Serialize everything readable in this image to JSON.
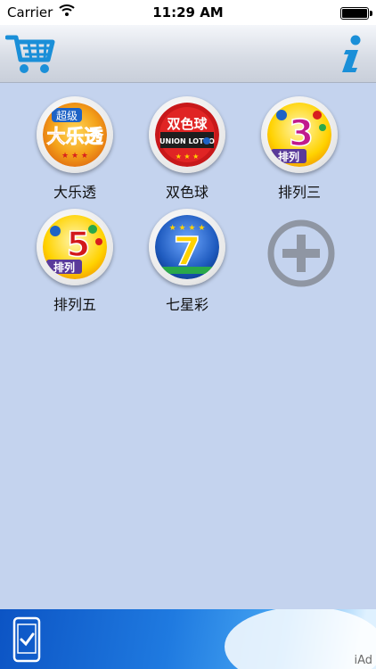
{
  "status_bar": {
    "carrier": "Carrier",
    "time": "11:29 AM"
  },
  "toolbar": {
    "cart_icon": "shopping-cart-icon",
    "info_icon": "info-icon",
    "accent_color": "#1a8fd8"
  },
  "lotteries": [
    {
      "label": "大乐透",
      "logo_text": [
        "超级",
        "大乐透"
      ],
      "colors": [
        "#e32b1c",
        "#f4b216"
      ]
    },
    {
      "label": "双色球",
      "logo_text": [
        "双色球",
        "UNION LOTTO"
      ],
      "colors": [
        "#d81e1e",
        "#1e1e1e"
      ]
    },
    {
      "label": "排列三",
      "logo_text": [
        "排列",
        "3"
      ],
      "colors": [
        "#c11a8d",
        "#ffd200"
      ]
    },
    {
      "label": "排列五",
      "logo_text": [
        "排列",
        "5"
      ],
      "colors": [
        "#d2181b",
        "#ffd200"
      ]
    },
    {
      "label": "七星彩",
      "logo_text": [
        "7"
      ],
      "colors": [
        "#1f5bbf",
        "#ffd200"
      ]
    }
  ],
  "add_button": {
    "icon": "plus-circle-icon"
  },
  "ad_banner": {
    "label": "iAd",
    "icon": "phone-check-icon"
  }
}
